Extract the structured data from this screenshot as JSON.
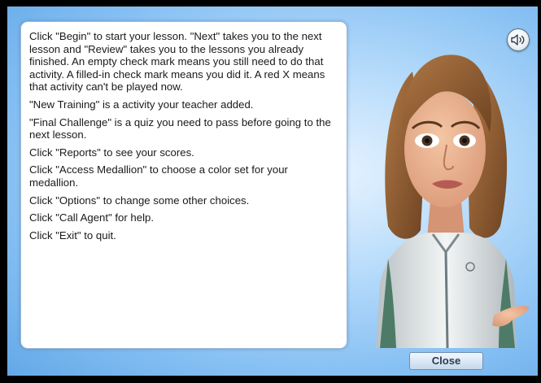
{
  "instructions": [
    "Click \"Begin\" to start your lesson. \"Next\" takes you to the next lesson and \"Review\" takes you to the lessons you already finished. An empty check mark means you still need to do that activity. A filled-in check mark means you did it. A red X means that activity can't be played now.",
    "\"New Training\" is a activity your teacher added.",
    "\"Final Challenge\" is a quiz you need to pass before going to the next lesson.",
    "Click \"Reports\" to see your scores.",
    "Click \"Access Medallion\" to choose a color set for your medallion.",
    "Click \"Options\" to change some other choices.",
    "Click \"Call Agent\" for help.",
    "Click \"Exit\" to quit."
  ],
  "buttons": {
    "close_label": "Close",
    "speaker_icon": "speaker-icon"
  },
  "avatar": {
    "icon": "avatar-character"
  },
  "colors": {
    "background_outer": "#000000",
    "dialog_light": "#e8f4ff",
    "dialog_dark": "#63a8e8",
    "panel": "#ffffff",
    "text": "#1a1a1a"
  }
}
